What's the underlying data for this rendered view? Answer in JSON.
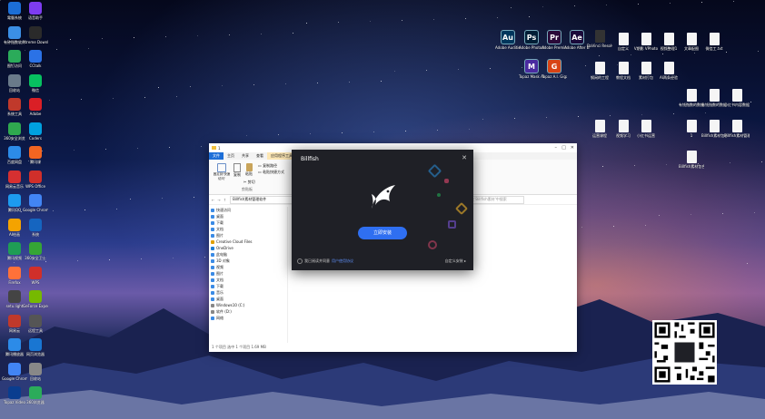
{
  "desktop": {
    "left_icons": [
      {
        "label": "電腦系統",
        "color": "#1c6ed6"
      },
      {
        "label": "有钟指数软件",
        "color": "#3b8fe5"
      },
      {
        "label": "图钉访问",
        "color": "#2bab5a"
      },
      {
        "label": "回收站",
        "color": "#6a7a8a"
      },
      {
        "label": "系统工具",
        "color": "#c0392b"
      },
      {
        "label": "360安全浏览",
        "color": "#2fa84f"
      },
      {
        "label": "百度网盘",
        "color": "#2c8be8"
      },
      {
        "label": "网易云音乐",
        "color": "#d63031"
      },
      {
        "label": "腾讯QQ",
        "color": "#1d9bf0"
      },
      {
        "label": "AI绘画",
        "color": "#f4a300"
      },
      {
        "label": "腾讯视频",
        "color": "#1f9d55"
      },
      {
        "label": "Firefox",
        "color": "#ff7139"
      },
      {
        "label": "setu.light",
        "color": "#444"
      },
      {
        "label": "网易云",
        "color": "#c0392b"
      },
      {
        "label": "腾讯播放器",
        "color": "#2c8be8"
      },
      {
        "label": "Google Chrome",
        "color": "#4285f4"
      },
      {
        "label": "Topaz Video",
        "color": "#0a3d8f"
      },
      {
        "label": "语音助手",
        "color": "#7d3cf0"
      },
      {
        "label": "Xtreme Download",
        "color": "#2a2a2a"
      },
      {
        "label": "CCtalk",
        "color": "#2b72e6"
      },
      {
        "label": "微信",
        "color": "#07c160"
      },
      {
        "label": "Adobe",
        "color": "#da1f26"
      },
      {
        "label": "Coders",
        "color": "#00a1e0"
      },
      {
        "label": "腾讯课",
        "color": "#f26522"
      },
      {
        "label": "WPS Office",
        "color": "#d02f2a"
      },
      {
        "label": "Google Chrome",
        "color": "#4285f4"
      },
      {
        "label": "系统",
        "color": "#1565c0"
      },
      {
        "label": "360安全卫士",
        "color": "#35a535"
      },
      {
        "label": "WPS",
        "color": "#d02f2a"
      },
      {
        "label": "GeForce Experience",
        "color": "#76b900"
      },
      {
        "label": "远程工具",
        "color": "#555"
      },
      {
        "label": "网页浏览器",
        "color": "#1976d2"
      },
      {
        "label": "回收站",
        "color": "#888"
      },
      {
        "label": "360浏览器",
        "color": "#2bab5a"
      }
    ],
    "right_icons": [
      {
        "label": "Adobe Audition",
        "abbr": "Au",
        "color": "#00365c"
      },
      {
        "label": "Adobe Photosh",
        "abbr": "Ps",
        "color": "#001e36"
      },
      {
        "label": "Adobe Premie",
        "abbr": "Pr",
        "color": "#2a0a38"
      },
      {
        "label": "Adobe After Effects 2021",
        "abbr": "Ae",
        "color": "#1a0a3a"
      },
      {
        "label": "DaVinci Resolve",
        "abbr": "",
        "color": "#333"
      },
      {
        "label": "自定义",
        "abbr": "",
        "color": "#f5f5f5"
      },
      {
        "label": "V期影 VPhoto",
        "abbr": "",
        "color": "#f5f5f5"
      },
      {
        "label": "视频整理1",
        "abbr": "",
        "color": "#f5f5f5"
      },
      {
        "label": "文章配图",
        "abbr": "",
        "color": "#f5f5f5"
      },
      {
        "label": "微信工.txt",
        "abbr": "",
        "color": "#f5f5f5"
      },
      {
        "label": "Topaz Mask AI",
        "abbr": "M",
        "color": "#4a2aa0"
      },
      {
        "label": "Topaz A.I. Gigapixel",
        "abbr": "G",
        "color": "#d84315"
      },
      {
        "label": "钢闲的工程",
        "abbr": "",
        "color": "#f5f5f5"
      },
      {
        "label": "教程文档",
        "abbr": "",
        "color": "#f5f5f5"
      },
      {
        "label": "素材打包",
        "abbr": "",
        "color": "#f5f5f5"
      },
      {
        "label": "AI两条经验",
        "abbr": "",
        "color": "#f5f5f5"
      },
      {
        "label": "有钱指数的数据.xlsx",
        "abbr": "",
        "color": "#f5f5f5"
      },
      {
        "label": "有钱指数的数据.png",
        "abbr": "",
        "color": "#f5f5f5"
      },
      {
        "label": "小红书内容数据.png",
        "abbr": "",
        "color": "#f5f5f5"
      },
      {
        "label": "运营课程",
        "abbr": "",
        "color": "#f5f5f5"
      },
      {
        "label": "视频学习",
        "abbr": "",
        "color": "#f5f5f5"
      },
      {
        "label": "小红书运营",
        "abbr": "",
        "color": "#f5f5f5"
      },
      {
        "label": "1",
        "abbr": "",
        "color": "#f5f5f5"
      },
      {
        "label": "Billfish素材包合集.rar",
        "abbr": "",
        "color": "#f5f5f5"
      },
      {
        "label": "Billfish素材管理软件.exe",
        "abbr": "",
        "color": "#f5f5f5"
      },
      {
        "label": "Billfish素材包合集",
        "abbr": "",
        "color": "#f5f5f5"
      }
    ]
  },
  "explorer": {
    "title": "1",
    "tabs": [
      "文件",
      "主页",
      "共享",
      "查看",
      "应用程序工具"
    ],
    "ribbon": {
      "pin_label": "固定到'快速访问'",
      "copy_label": "复制",
      "paste_label": "粘贴",
      "copy_path_label": "复制路径",
      "paste_shortcut_label": "粘贴快捷方式",
      "cut_label": "剪切",
      "group_label": "剪贴板"
    },
    "address": "Billfish素材管理软件",
    "search_placeholder": "在'Billfish素材'中搜索",
    "nav": [
      {
        "label": "快速访问",
        "color": "#3b8be5"
      },
      {
        "label": "桌面",
        "color": "#3b8be5"
      },
      {
        "label": "下载",
        "color": "#3b8be5"
      },
      {
        "label": "文档",
        "color": "#3b8be5"
      },
      {
        "label": "图片",
        "color": "#3b8be5"
      },
      {
        "label": "Creative Cloud Files",
        "color": "#e0a000"
      },
      {
        "label": "OneDrive",
        "color": "#1e7fd8"
      },
      {
        "label": "此电脑",
        "color": "#3b8be5"
      },
      {
        "label": "3D 对象",
        "color": "#3b8be5"
      },
      {
        "label": "视频",
        "color": "#3b8be5"
      },
      {
        "label": "图片",
        "color": "#3b8be5"
      },
      {
        "label": "文档",
        "color": "#3b8be5"
      },
      {
        "label": "下载",
        "color": "#3b8be5"
      },
      {
        "label": "音乐",
        "color": "#3b8be5"
      },
      {
        "label": "桌面",
        "color": "#3b8be5"
      },
      {
        "label": "Windows10 (C:)",
        "color": "#888"
      },
      {
        "label": "软件 (D:)",
        "color": "#888"
      },
      {
        "label": "网络",
        "color": "#3b8be5"
      }
    ],
    "status": "1 个项目    选中 1 个项目  1.69 MB"
  },
  "dialog": {
    "title": "Billfish",
    "install_label": "立即安装",
    "agree_text": "我已阅读并同意",
    "agreement_link": "用户使用协议",
    "custom_install": "自定义安装"
  },
  "colors": {
    "accent": "#2f6ff1",
    "dialog_bg": "#1f2026"
  }
}
